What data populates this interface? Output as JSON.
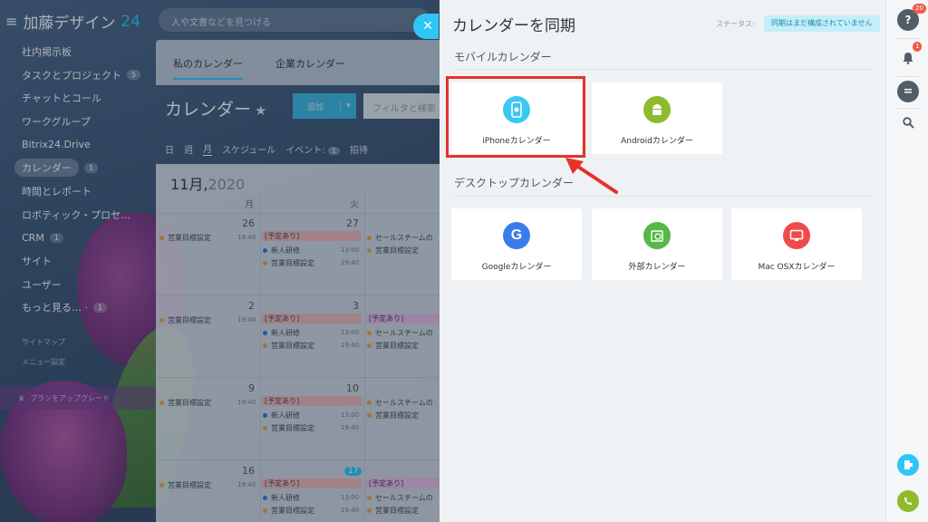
{
  "app": {
    "logo_name": "加藤デザイン",
    "logo_num": "24",
    "search_placeholder": "人や文書などを見つける"
  },
  "sidebar": {
    "items": [
      {
        "label": "社内掲示板",
        "count": ""
      },
      {
        "label": "タスクとプロジェクト",
        "count": "5"
      },
      {
        "label": "チャットとコール",
        "count": ""
      },
      {
        "label": "ワークグループ",
        "count": ""
      },
      {
        "label": "Bitrix24.Drive",
        "count": ""
      },
      {
        "label": "カレンダー",
        "count": "1"
      },
      {
        "label": "時間とレポート",
        "count": ""
      },
      {
        "label": "ロボティック・プロセ…",
        "count": ""
      },
      {
        "label": "CRM",
        "count": "1"
      },
      {
        "label": "サイト",
        "count": ""
      },
      {
        "label": "ユーザー",
        "count": ""
      },
      {
        "label": "もっと見る… ·",
        "count": "1"
      }
    ],
    "sitemap": "サイトマップ",
    "menu_settings": "メニュー設定",
    "upgrade": "プランをアップグレード"
  },
  "calendar": {
    "tabs": [
      "私のカレンダー",
      "企業カレンダー"
    ],
    "title": "カレンダー",
    "add": "追加",
    "filter_placeholder": "フィルタと検索",
    "views": [
      "日",
      "週",
      "月",
      "スケジュール"
    ],
    "events_label": "イベント:",
    "events_count": "1",
    "invite": "招待",
    "month": "11月,",
    "year": "2020",
    "dow": [
      "月",
      "火"
    ],
    "weeks": [
      {
        "mon": "26",
        "tue": "27"
      },
      {
        "mon": "2",
        "tue": "3"
      },
      {
        "mon": "9",
        "tue": "10"
      },
      {
        "mon": "16",
        "tue": "17"
      }
    ],
    "ev_goal": "営業目標設定",
    "ev_goal_time": "19:40",
    "ev_busy": "[予定あり]",
    "ev_training": "新人研修",
    "ev_training_time": "13:00",
    "ev_sales": "セールスチームの",
    "ev_busy2": "[予定あり]"
  },
  "panel": {
    "title": "カレンダーを同期",
    "status_label": "ステータス:",
    "status_value": "同期はまだ構成されていません",
    "mobile_heading": "モバイルカレンダー",
    "desktop_heading": "デスクトップカレンダー",
    "mobile_cards": [
      {
        "label": "iPhoneカレンダー",
        "icon": "apple-icon",
        "color": "#3bc8f5"
      },
      {
        "label": "Androidカレンダー",
        "icon": "android-icon",
        "color": "#8dbb2c"
      }
    ],
    "desktop_cards": [
      {
        "label": "Googleカレンダー",
        "icon": "google-icon",
        "color": "#3a7ce9"
      },
      {
        "label": "外部カレンダー",
        "icon": "external-sync-icon",
        "color": "#55b847"
      },
      {
        "label": "Mac OSXカレンダー",
        "icon": "mac-icon",
        "color": "#ef4b4b"
      }
    ]
  },
  "rail": {
    "help_badge": "20",
    "notif_badge": "1"
  },
  "colors": {
    "accent": "#2fc6f6",
    "highlight": "#e5332a"
  }
}
